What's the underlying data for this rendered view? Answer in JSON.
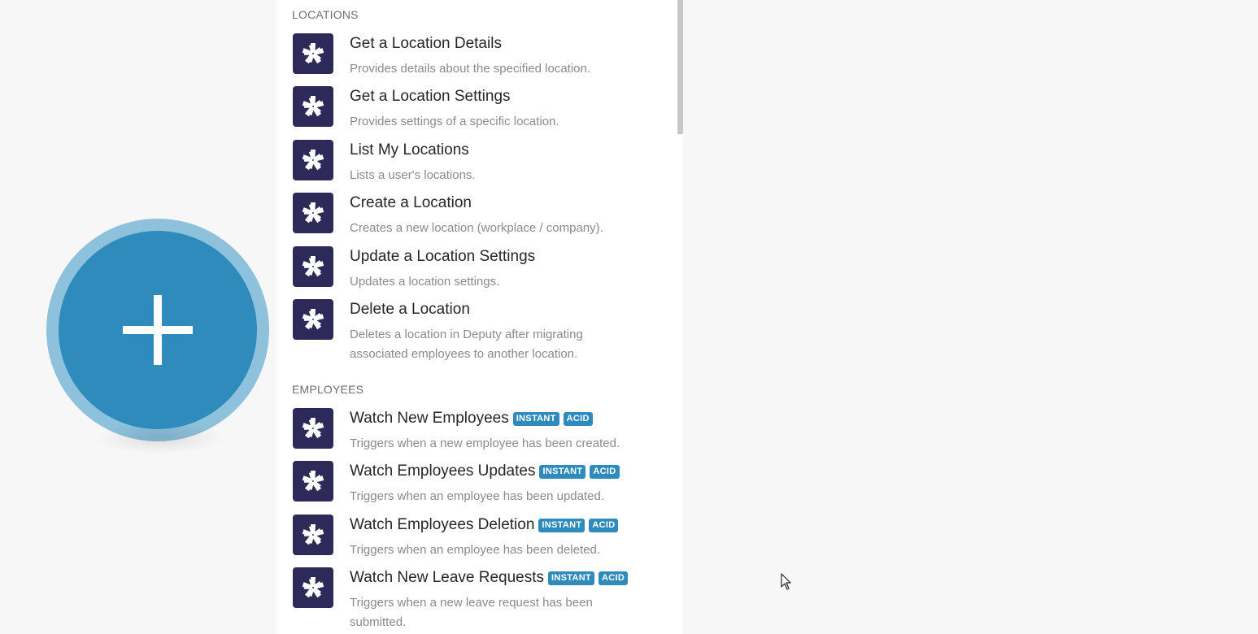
{
  "sections": [
    {
      "header": "LOCATIONS",
      "items": [
        {
          "title": "Get a Location Details",
          "desc": "Provides details about the specified location."
        },
        {
          "title": "Get a Location Settings",
          "desc": "Provides settings of a specific location."
        },
        {
          "title": "List My Locations",
          "desc": "Lists a user's locations."
        },
        {
          "title": "Create a Location",
          "desc": "Creates a new location (workplace / company)."
        },
        {
          "title": "Update a Location Settings",
          "desc": "Updates a location settings."
        },
        {
          "title": "Delete a Location",
          "desc": "Deletes a location in Deputy after migrating associated employees to another location."
        }
      ]
    },
    {
      "header": "EMPLOYEES",
      "items": [
        {
          "title": "Watch New Employees",
          "badges": [
            "INSTANT",
            "ACID"
          ],
          "desc": "Triggers when a new employee has been created."
        },
        {
          "title": "Watch Employees Updates",
          "badges": [
            "INSTANT",
            "ACID"
          ],
          "desc": "Triggers when an employee has been updated."
        },
        {
          "title": "Watch Employees Deletion",
          "badges": [
            "INSTANT",
            "ACID"
          ],
          "desc": "Triggers when an employee has been deleted."
        },
        {
          "title": "Watch New Leave Requests",
          "badges": [
            "INSTANT",
            "ACID"
          ],
          "desc": "Triggers when a new leave request has been submitted."
        }
      ]
    }
  ],
  "icons": {
    "app_icon": "deputy-app-icon",
    "add_module": "plus-icon",
    "cursor": "mouse-cursor-icon"
  },
  "colors": {
    "background": "#f7f7f7",
    "add_module_fill": "#2e8bbb",
    "add_module_ring": "#8ec1db",
    "app_icon_bg": "#2d2a5a",
    "badge_bg": "#2e8bbb"
  }
}
